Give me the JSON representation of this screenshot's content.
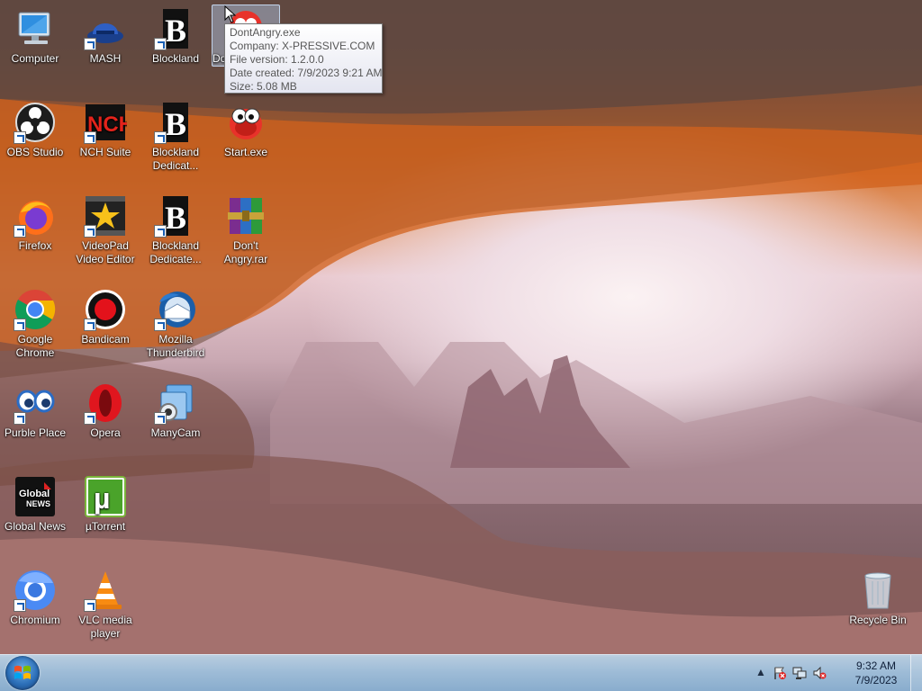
{
  "desktop": {
    "icons": [
      {
        "label": "Computer"
      },
      {
        "label": "MASH"
      },
      {
        "label": "Blockland"
      },
      {
        "label": "OBS Studio"
      },
      {
        "label": "NCH Suite"
      },
      {
        "label": "Blockland Dedicat..."
      },
      {
        "label": "Start.exe"
      },
      {
        "label": "Firefox"
      },
      {
        "label": "VideoPad Video Editor"
      },
      {
        "label": "Blockland Dedicate..."
      },
      {
        "label": "Don't Angry.rar"
      },
      {
        "label": "Google Chrome"
      },
      {
        "label": "Bandicam"
      },
      {
        "label": "Mozilla Thunderbird"
      },
      {
        "label": "Purble Place"
      },
      {
        "label": "Opera"
      },
      {
        "label": "ManyCam"
      },
      {
        "label": "Global News"
      },
      {
        "label": "µTorrent"
      },
      {
        "label": "Chromium"
      },
      {
        "label": "VLC media player"
      },
      {
        "label": "Recycle Bin"
      },
      {
        "label": "Do"
      }
    ]
  },
  "tooltip": {
    "name": "DontAngry.exe",
    "company": "Company: X-PRESSIVE.COM",
    "version": "File version: 1.2.0.0",
    "created": "Date created: 7/9/2023 9:21 AM",
    "size": "Size: 5.08 MB"
  },
  "taskbar": {
    "time": "9:32 AM",
    "date": "7/9/2023"
  }
}
